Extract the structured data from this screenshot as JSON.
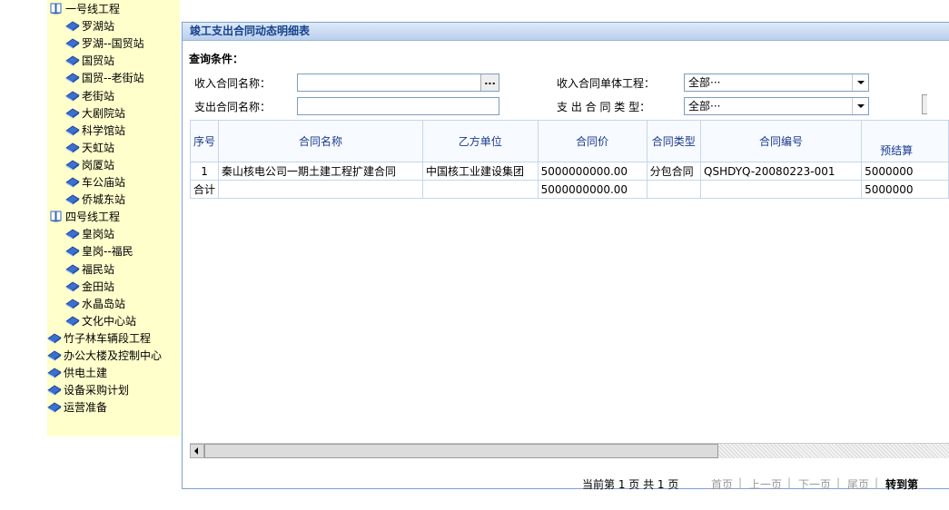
{
  "tree": {
    "nodes": [
      {
        "label": "一号线工程",
        "icon": "books-icon",
        "level": 0
      },
      {
        "label": "罗湖站",
        "icon": "book-icon",
        "level": 1
      },
      {
        "label": "罗湖--国贸站",
        "icon": "book-icon",
        "level": 1
      },
      {
        "label": "国贸站",
        "icon": "book-icon",
        "level": 1
      },
      {
        "label": "国贸--老街站",
        "icon": "book-icon",
        "level": 1
      },
      {
        "label": "老街站",
        "icon": "book-icon",
        "level": 1
      },
      {
        "label": "大剧院站",
        "icon": "book-icon",
        "level": 1
      },
      {
        "label": "科学馆站",
        "icon": "book-icon",
        "level": 1
      },
      {
        "label": "天虹站",
        "icon": "book-icon",
        "level": 1
      },
      {
        "label": "岗厦站",
        "icon": "book-icon",
        "level": 1
      },
      {
        "label": "车公庙站",
        "icon": "book-icon",
        "level": 1
      },
      {
        "label": "侨城东站",
        "icon": "book-icon",
        "level": 1
      },
      {
        "label": "四号线工程",
        "icon": "books-icon",
        "level": 0
      },
      {
        "label": "皇岗站",
        "icon": "book-icon",
        "level": 1
      },
      {
        "label": "皇岗--福民",
        "icon": "book-icon",
        "level": 1
      },
      {
        "label": "福民站",
        "icon": "book-icon",
        "level": 1
      },
      {
        "label": "金田站",
        "icon": "book-icon",
        "level": 1
      },
      {
        "label": "水晶岛站",
        "icon": "book-icon",
        "level": 1
      },
      {
        "label": "文化中心站",
        "icon": "book-icon",
        "level": 1
      },
      {
        "label": "竹子林车辆段工程",
        "icon": "book-icon",
        "level": 0
      },
      {
        "label": "办公大楼及控制中心",
        "icon": "book-icon",
        "level": 0
      },
      {
        "label": "供电土建",
        "icon": "book-icon",
        "level": 0
      },
      {
        "label": "设备采购计划",
        "icon": "book-icon",
        "level": 0
      },
      {
        "label": "运营准备",
        "icon": "book-icon",
        "level": 0
      }
    ]
  },
  "panel": {
    "title": "竣工支出合同动态明细表",
    "query_heading": "查询条件：",
    "fields": {
      "income_contract_label": "收入合同名称：",
      "income_contract_value": "",
      "dots_button": "...",
      "expense_contract_label": "支出合同名称：",
      "expense_contract_value": "",
      "income_unit_label": "收入合同单体工程：",
      "income_unit_value": "全部···",
      "expense_type_label": "支 出 合 同 类 型：",
      "expense_type_value": "全部···"
    },
    "table": {
      "headers": [
        "序号",
        "合同名称",
        "乙方单位",
        "合同价",
        "合同类型",
        "合同编号",
        "预结算"
      ],
      "rows": [
        [
          "1",
          "秦山核电公司一期土建工程扩建合同",
          "中国核工业建设集团",
          "5000000000.00",
          "分包合同",
          "QSHDYQ-20080223-001",
          "5000000"
        ]
      ],
      "total": [
        "合计",
        "",
        "",
        "5000000000.00",
        "",
        "",
        "5000000"
      ]
    },
    "pager": {
      "current": "当前第 1 页 共 1 页",
      "first": "首页",
      "prev": "上一页",
      "next": "下一页",
      "last": "尾页",
      "goto": "转到第"
    }
  },
  "colors": {
    "tree_bg": "#ffffcc",
    "panel_border": "#7ba3d2",
    "title_text": "#15428b"
  }
}
